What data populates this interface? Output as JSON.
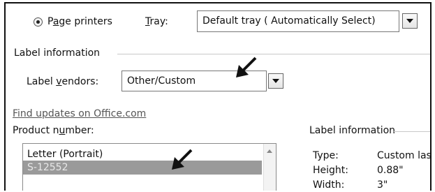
{
  "printer": {
    "page_printers_label": "Page printers",
    "tray_label": "Tray:",
    "tray_value": "Default tray ( Automatically Select)"
  },
  "label_info_group": {
    "title": "Label information"
  },
  "vendors": {
    "label": "Label vendors:",
    "value": "Other/Custom"
  },
  "find_updates_link": "Find updates on Office.com",
  "product_number": {
    "label": "Product number:",
    "items": [
      "Letter (Portrait)",
      "S-12552"
    ],
    "selected_index": 1
  },
  "details": {
    "title": "Label information",
    "rows": [
      {
        "key": "Type:",
        "value": "Custom las"
      },
      {
        "key": "Height:",
        "value": "0.88\""
      },
      {
        "key": "Width:",
        "value": "3\""
      }
    ]
  },
  "colors": {
    "selection": "#9a9a9a",
    "link": "#555555",
    "annotation_arrow": "#111111"
  },
  "icons": {
    "dropdown": "chevron-down-icon",
    "annotation": "arrow-pointer-icon"
  }
}
